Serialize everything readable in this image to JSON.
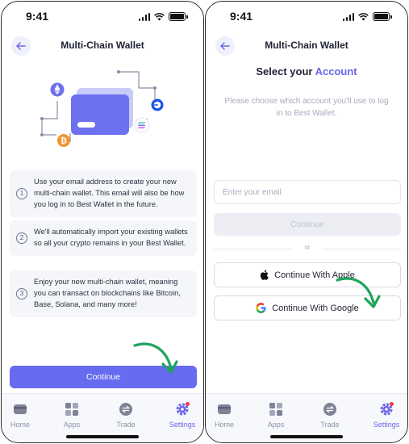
{
  "status": {
    "time": "9:41"
  },
  "left": {
    "header_title": "Multi-Chain Wallet",
    "steps": [
      {
        "num": "1",
        "text": "Use your email address to create your new multi-chain wallet. This email will also be how you log in to Best Wallet in the future."
      },
      {
        "num": "2",
        "text": "We'll automatically import your existing wallets so all your crypto remains in your Best Wallet."
      },
      {
        "num": "3",
        "text": "Enjoy your new multi-chain wallet, meaning you can transact on blockchains like Bitcoin, Base, Solana, and many more!"
      }
    ],
    "continue_label": "Continue"
  },
  "right": {
    "header_title": "Multi-Chain Wallet",
    "title_prefix": "Select your",
    "title_accent": "Account",
    "subtitle": "Please choose which account you'll use to log in to Best Wallet.",
    "email_placeholder": "Enter your email",
    "continue_label": "Continue",
    "or_label": "or",
    "apple_label": "Continue With Apple",
    "google_label": "Continue With Google"
  },
  "tabs": [
    {
      "label": "Home",
      "icon": "wallet-icon"
    },
    {
      "label": "Apps",
      "icon": "grid-icon"
    },
    {
      "label": "Trade",
      "icon": "swap-icon"
    },
    {
      "label": "Settings",
      "icon": "gear-icon",
      "active": true
    }
  ],
  "colors": {
    "accent": "#676bf0",
    "arrow": "#1fa35c",
    "disabled": "#eceef3"
  }
}
